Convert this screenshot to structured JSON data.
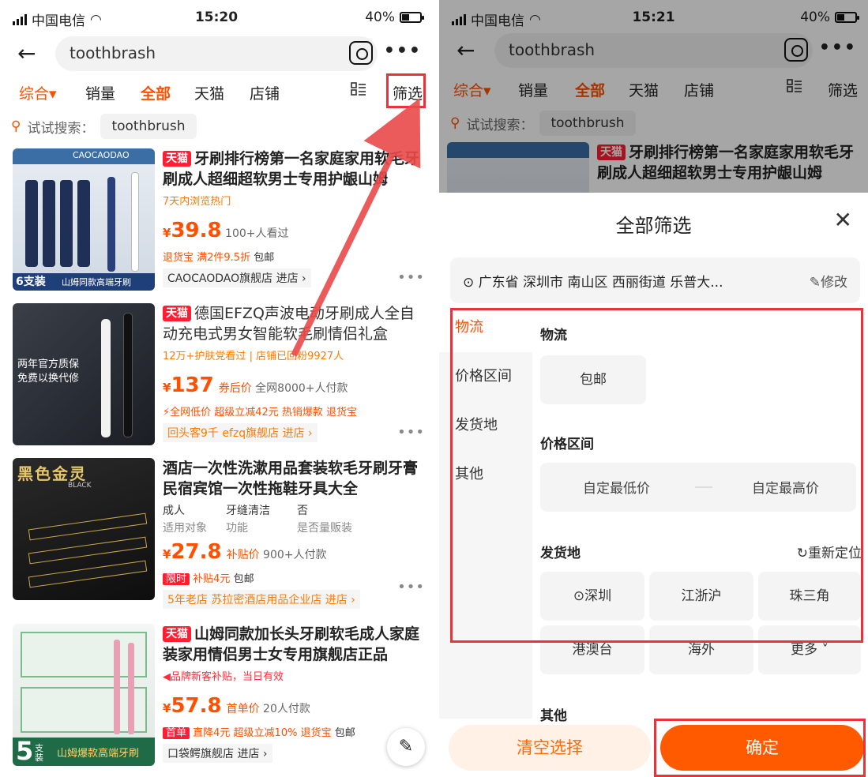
{
  "left": {
    "status": {
      "carrier": "中国电信",
      "time": "15:20",
      "battery": "40%"
    },
    "search": {
      "query": "toothbrash"
    },
    "tabs": [
      "综合▾",
      "销量",
      "全部",
      "天猫",
      "店铺",
      "筛选"
    ],
    "suggest": {
      "label": "试试搜索：",
      "chip": "toothbrush"
    },
    "products": [
      {
        "badge": "天猫",
        "title": "牙刷排行榜第一名家庭家用软毛牙刷成人超细超软男士专用护龈山姆",
        "sub": "7天内浏览热门",
        "price_prefix": "¥",
        "price": "39.8",
        "price_note": "100+人看过",
        "promo": "退货宝  满2件9.5折",
        "promo_extra": "包邮",
        "shop": "CAOCAODAO旗舰店 进店 ›",
        "thumb_label": "6支装",
        "thumb_label2": "山姆同款高端牙刷",
        "thumb_brand": "CAOCAODAO"
      },
      {
        "badge": "天猫",
        "title": "德国EFZQ声波电动牙刷成人全自动充电式男女智能软毛刷情侣礼盒",
        "sub": "12万+护肤党看过 | 店铺已回粉9927人",
        "price_prefix": "¥",
        "price": "137",
        "price_tag": "券后价",
        "price_note": "全网8000+人付款",
        "promo": "⚡全网低价  超级立减42元  热销爆款  退货宝",
        "shop": "回头客9千 efzq旗舰店 进店 ›",
        "thumb_text1": "两年官方质保",
        "thumb_text2": "免费以换代修"
      },
      {
        "title": "酒店一次性洗漱用品套装软毛牙刷牙膏民宿宾馆一次性拖鞋牙具大全",
        "attrs": [
          {
            "v": "成人",
            "l": "适用对象"
          },
          {
            "v": "牙缝清洁",
            "l": "功能"
          },
          {
            "v": "否",
            "l": "是否量贩装"
          }
        ],
        "price_prefix": "¥",
        "price": "27.8",
        "price_tag": "补贴价",
        "price_note": "900+人付款",
        "promo_badge": "限时",
        "promo": "补贴4元",
        "promo_extra": "包邮",
        "shop": "5年老店 苏拉密酒店用品企业店 进店 ›",
        "thumb_title": "黑色金灵",
        "thumb_small": "BLACK"
      },
      {
        "badge": "天猫",
        "title": "山姆同款加长头牙刷软毛成人家庭装家用情侣男士女专用旗舰店正品",
        "sub": "品牌新客补贴，当日有效",
        "price_prefix": "¥",
        "price": "57.8",
        "price_tag": "首单价",
        "price_note": "20人付款",
        "promo_badge": "首单",
        "promo": "直降4元  超级立减10%  退货宝",
        "promo_extra": "包邮",
        "shop": "口袋鳄旗舰店 进店 ›",
        "thumb_num": "5",
        "thumb_unit": "支装",
        "thumb_label": "山姆爆款高端牙刷"
      }
    ]
  },
  "right": {
    "status": {
      "carrier": "中国电信",
      "time": "15:21",
      "battery": "40%"
    },
    "search": {
      "query": "toothbrash"
    },
    "tabs": [
      "综合▾",
      "销量",
      "全部",
      "天猫",
      "店铺",
      "筛选"
    ],
    "suggest": {
      "label": "试试搜索：",
      "chip": "toothbrush"
    },
    "peek_title": "牙刷排行榜第一名家庭家用软毛牙刷成人超细超软男士专用护龈山姆",
    "peek_badge": "天猫",
    "panel": {
      "title": "全部筛选",
      "address": "广东省 深圳市 南山区 西丽街道 乐普大...",
      "edit": "修改",
      "sidebar": [
        "物流",
        "价格区间",
        "发货地",
        "其他"
      ],
      "logistics_title": "物流",
      "logistics_opt": "包邮",
      "price_title": "价格区间",
      "price_min": "自定最低价",
      "price_max": "自定最高价",
      "origin_title": "发货地",
      "relocate": "重新定位",
      "origins": [
        "深圳",
        "江浙沪",
        "珠三角",
        "港澳台",
        "海外",
        "更多"
      ],
      "other_title": "其他",
      "clear": "清空选择",
      "confirm": "确定"
    }
  }
}
